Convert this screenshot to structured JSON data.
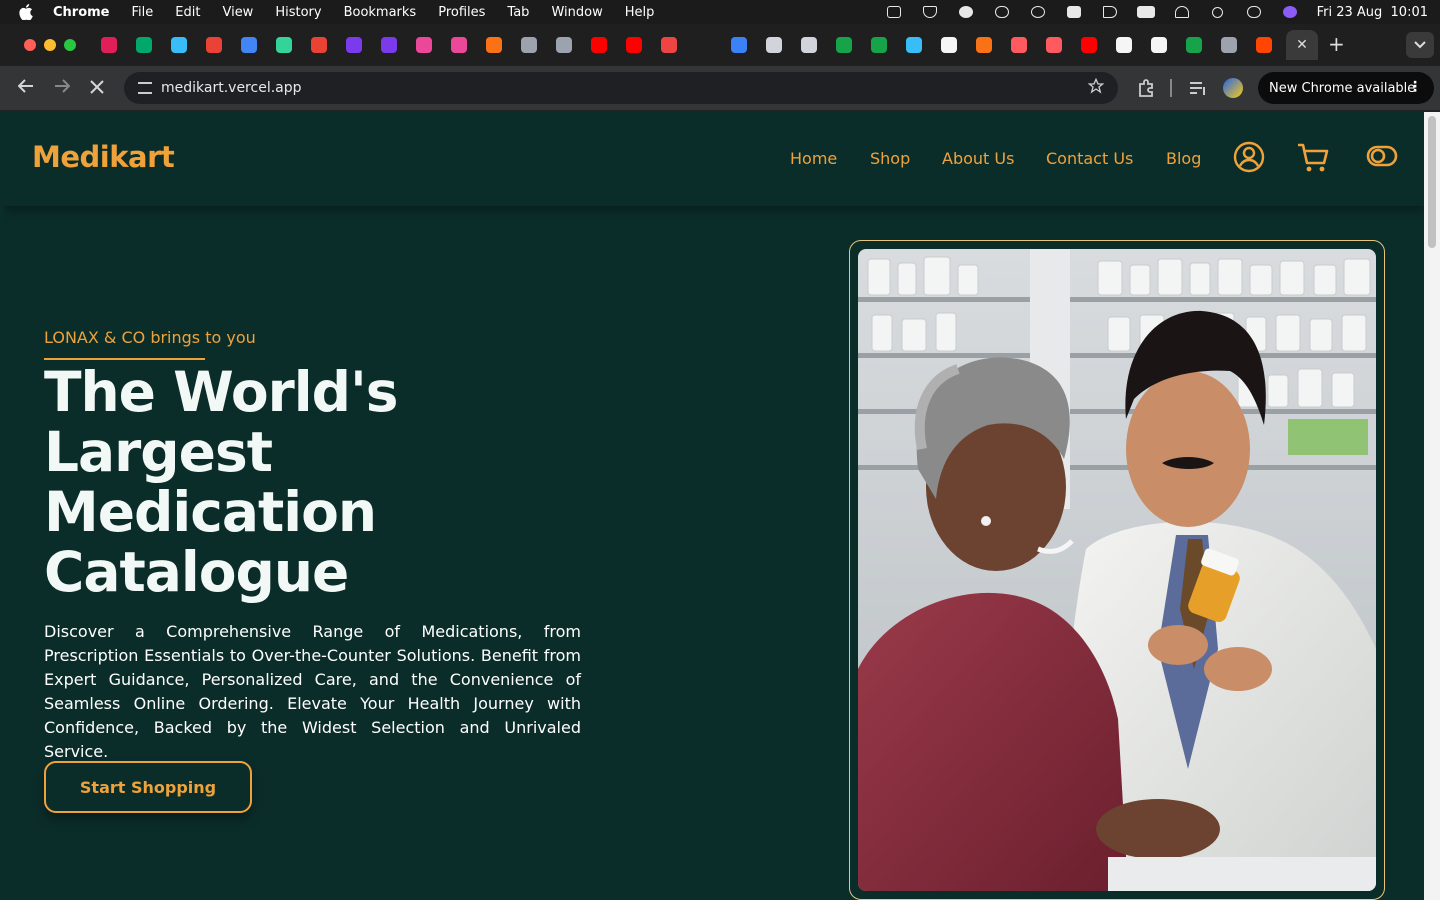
{
  "menubar": {
    "app_name": "Chrome",
    "items": [
      "File",
      "Edit",
      "View",
      "History",
      "Bookmarks",
      "Profiles",
      "Tab",
      "Window",
      "Help"
    ],
    "datetime": "Fri 23 Aug  10:01"
  },
  "browser": {
    "url": "medikart.vercel.app",
    "update_label": "New Chrome available",
    "active_tab_close": "✕",
    "new_tab_symbol": "+",
    "favicon_colors": [
      "#e01e5a",
      "#00a86b",
      "#38bdf8",
      "#ea4335",
      "#4285f4",
      "#34d399",
      "#ea4335",
      "#7c3aed",
      "#7c3aed",
      "#ec4899",
      "#ec4899",
      "#f97316",
      "#9ca3af",
      "#9ca3af",
      "#ff0000",
      "#ff0000",
      "#ef4444",
      "#1f1f1f",
      "#3b82f6",
      "#d1d5db",
      "#d1d5db",
      "#16a34a",
      "#16a34a",
      "#38bdf8",
      "#f5f5f5",
      "#f97316",
      "#ff5a5f",
      "#ff5a5f",
      "#ff0000",
      "#f5f5f5",
      "#f5f5f5",
      "#16a34a",
      "#9ca3af",
      "#ff4500"
    ]
  },
  "site": {
    "logo": "Medikart",
    "nav": {
      "home": "Home",
      "shop": "Shop",
      "about": "About Us",
      "contact": "Contact Us",
      "blog": "Blog"
    },
    "icons": {
      "account": "user-circle-icon",
      "cart": "cart-icon",
      "theme": "toggle-icon"
    },
    "hero": {
      "eyebrow": "LONAX & CO brings to you",
      "title_lines": [
        "The World's",
        "Largest",
        "Medication",
        "Catalogue"
      ],
      "description": "Discover a Comprehensive Range of Medications, from Prescription Essentials to Over-the-Counter Solutions. Benefit from Expert Guidance, Personalized Care, and the Convenience of Seamless Online Ordering. Elevate Your Health Journey with Confidence, Backed by the Widest Selection and Unrivaled Service.",
      "cta_label": "Start Shopping"
    },
    "colors": {
      "background": "#0b2d2a",
      "accent": "#f0a23a",
      "heading": "#f1f8f6"
    }
  }
}
